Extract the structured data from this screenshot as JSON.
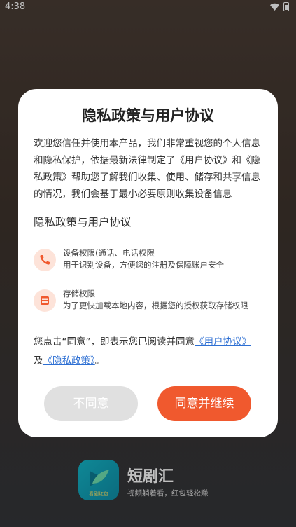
{
  "status_bar": {
    "time": "4:38"
  },
  "dialog": {
    "title": "隐私政策与用户协议",
    "body": "欢迎您信任并使用本产品，我们非常重视您的个人信息和隐私保护，依据最新法律制定了《用户协议》和《隐私政策》帮助您了解我们收集、使用、储存和共享信息的情况，我们会基于最小必要原则收集设备信息",
    "section_title": "隐私政策与用户协议",
    "permissions": [
      {
        "icon": "phone-icon",
        "title": "设备权限(通话、电话权限",
        "desc": "用于识别设备，方便您的注册及保障账户安全"
      },
      {
        "icon": "storage-icon",
        "title": "存储权限",
        "desc": "为了更快加载本地内容，根据您的授权获取存储权限"
      }
    ],
    "agree": {
      "prefix": "您点击“同意”，即表示您已阅读并同意",
      "link_user": "《用户协议》",
      "mid": "及",
      "link_privacy": "《隐私政策》",
      "suffix": "。"
    },
    "decline_label": "不同意",
    "accept_label": "同意并继续"
  },
  "app": {
    "icon_label": "看剧红包",
    "name": "短剧汇",
    "slogan": "视频躺着看，红包轻松赚"
  },
  "colors": {
    "accent": "#f0592e",
    "link": "#2d6fd3",
    "icon_bg": "#fde3d9"
  }
}
